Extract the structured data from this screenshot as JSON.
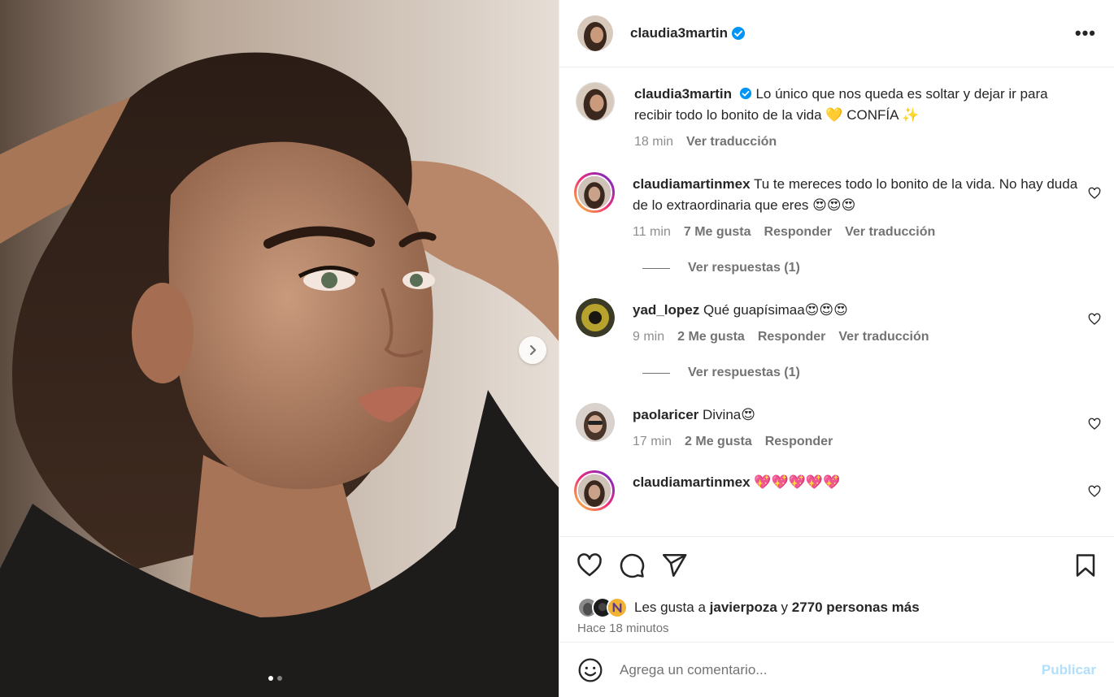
{
  "header": {
    "username": "claudia3martin",
    "more_label": "•••"
  },
  "caption": {
    "username": "claudia3martin",
    "text": "Lo único que nos queda es soltar y dejar ir para recibir todo lo bonito de la vida 💛 CONFÍA ✨",
    "time": "18 min",
    "translate": "Ver traducción"
  },
  "comments": [
    {
      "username": "claudiamartinmex",
      "text": "Tu te mereces todo lo bonito de la vida. No hay duda de lo extraordinaria que eres 😍😍😍",
      "time": "11 min",
      "likes": "7 Me gusta",
      "reply": "Responder",
      "translate": "Ver traducción",
      "replies": "Ver respuestas (1)"
    },
    {
      "username": "yad_lopez",
      "text": "Qué guapísimaa😍😍😍",
      "time": "9 min",
      "likes": "2 Me gusta",
      "reply": "Responder",
      "translate": "Ver traducción",
      "replies": "Ver respuestas (1)"
    },
    {
      "username": "paolaricer",
      "text": "Divina😍",
      "time": "17 min",
      "likes": "2 Me gusta",
      "reply": "Responder"
    },
    {
      "username": "claudiamartinmex",
      "text": "💖💖💖💖💖"
    }
  ],
  "likes": {
    "prefix": "Les gusta a",
    "user": "javierpoza",
    "conj": "y",
    "others": "2770 personas más"
  },
  "time_ago": "Hace 18 minutos",
  "add_comment": {
    "placeholder": "Agrega un comentario...",
    "post_label": "Publicar"
  },
  "colors": {
    "verified": "#0095f6",
    "post_button": "#b2dffc"
  },
  "carousel": {
    "slide": 1,
    "total": 2
  }
}
